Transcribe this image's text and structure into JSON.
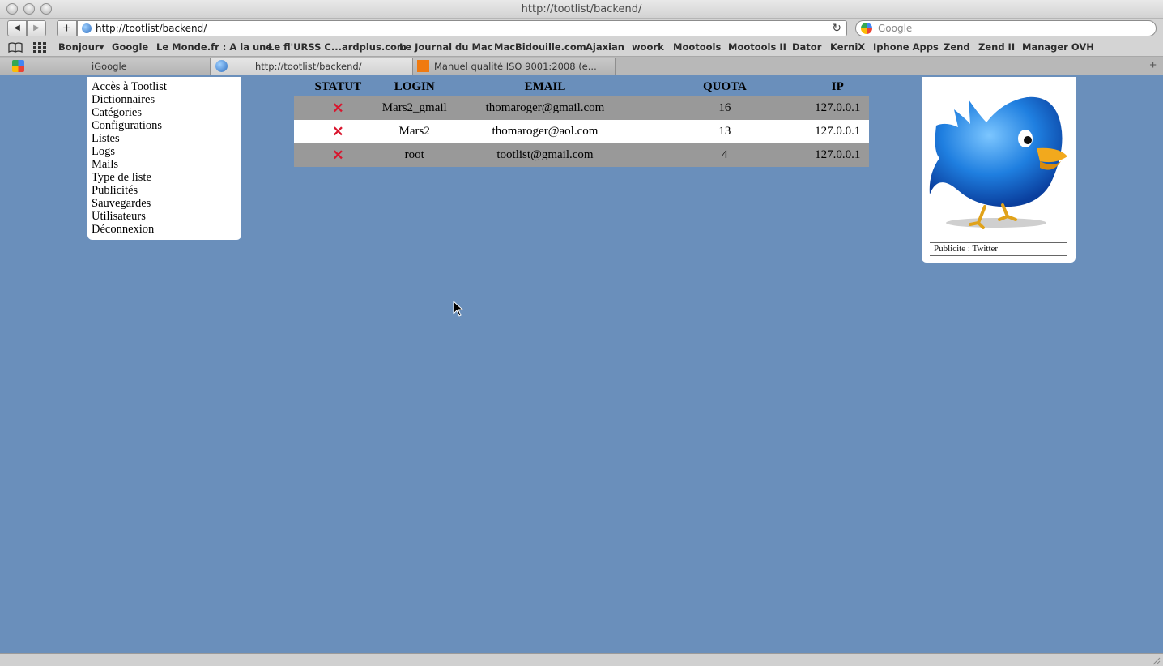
{
  "window": {
    "title": "http://tootlist/backend/"
  },
  "toolbar": {
    "url": "http://tootlist/backend/",
    "search_placeholder": "Google",
    "back_glyph": "◀",
    "forward_glyph": "▶",
    "add_glyph": "+",
    "reload_glyph": "↻"
  },
  "bookmarks": [
    "Bonjour▾",
    "Google",
    "Le Monde.fr : A la une",
    "Le fl'URSS C...ardplus.com",
    "Le Journal du Mac",
    "MacBidouille.com",
    "Ajaxian",
    "woork",
    "Mootools",
    "Mootools II",
    "Dator",
    "KerniX",
    "Iphone Apps",
    "Zend",
    "Zend II",
    "Manager OVH"
  ],
  "tabs": [
    {
      "label": "iGoogle"
    },
    {
      "label": "http://tootlist/backend/"
    },
    {
      "label": "Manuel qualité ISO 9001:2008 (e..."
    }
  ],
  "sidebar": {
    "items": [
      "Accès à Tootlist",
      "Dictionnaires",
      "Catégories",
      "Configurations",
      "Listes",
      "Logs",
      "Mails",
      "Type de liste",
      "Publicités",
      "Sauvegardes",
      "Utilisateurs",
      "Déconnexion"
    ]
  },
  "table": {
    "headers": [
      "STATUT",
      "LOGIN",
      "EMAIL",
      "QUOTA",
      "IP"
    ],
    "rows": [
      {
        "status": "✕",
        "login": "Mars2_gmail",
        "email": "thomaroger@gmail.com",
        "quota": "16",
        "ip": "127.0.0.1"
      },
      {
        "status": "✕",
        "login": "Mars2",
        "email": "thomaroger@aol.com",
        "quota": "13",
        "ip": "127.0.0.1"
      },
      {
        "status": "✕",
        "login": "root",
        "email": "tootlist@gmail.com",
        "quota": "4",
        "ip": "127.0.0.1"
      }
    ]
  },
  "ad": {
    "caption": "Publicite : Twitter"
  },
  "colors": {
    "page_bg": "#6a8fbb",
    "row_grey": "#999999",
    "status_x": "#d9162e"
  }
}
